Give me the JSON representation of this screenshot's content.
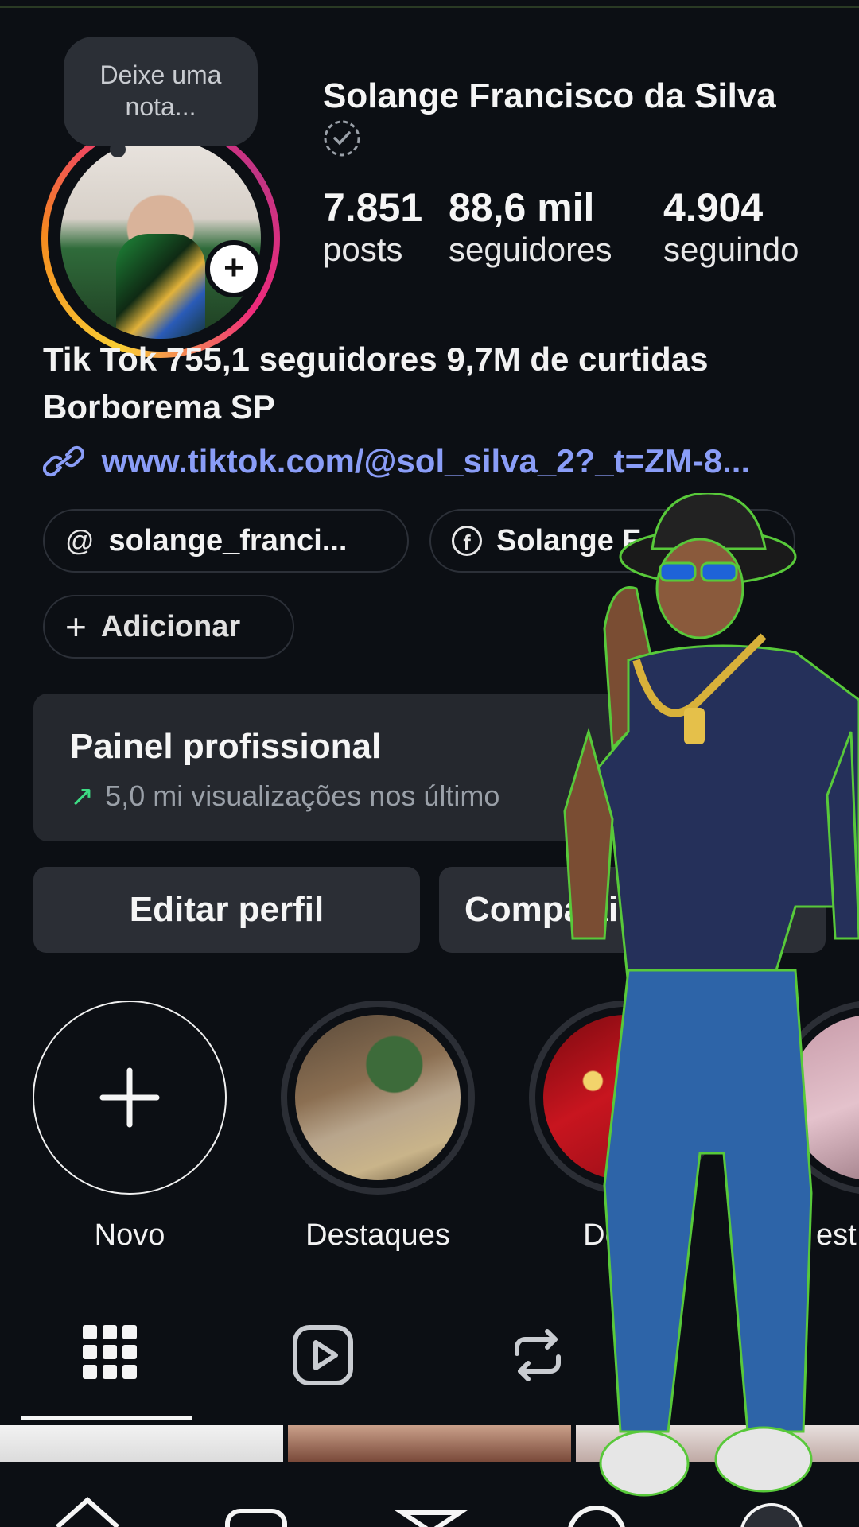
{
  "note": {
    "text": "Deixe uma nota..."
  },
  "profile": {
    "name": "Solange Francisco da Silva",
    "stats": [
      {
        "value": "7.851",
        "label": "posts"
      },
      {
        "value": "88,6 mil",
        "label": "seguidores"
      },
      {
        "value": "4.904",
        "label": "seguindo"
      }
    ],
    "bio_lines": [
      "Tik Tok 755,1 seguidores 9,7M de curtidas",
      "Borborema SP"
    ],
    "link": "www.tiktok.com/@sol_silva_2?_t=ZM-8..."
  },
  "chips": [
    {
      "icon": "threads-icon",
      "label": "solange_franci..."
    },
    {
      "icon": "facebook-icon",
      "label": "Solange F"
    },
    {
      "icon": "plus-icon",
      "label": "Adicionar"
    }
  ],
  "panel": {
    "title": "Painel profissional",
    "subtitle": "5,0 mi visualizações nos último"
  },
  "buttons": {
    "edit": "Editar perfil",
    "share": "Comparti"
  },
  "highlights": [
    {
      "label": "Novo"
    },
    {
      "label": "Destaques"
    },
    {
      "label": "Dest    s"
    },
    {
      "label": "est"
    }
  ],
  "colors": {
    "background": "#0c0f14",
    "link": "#8a9df7",
    "panel": "#25282e",
    "button": "#2b2e35",
    "accent_green": "#3ddc84"
  }
}
